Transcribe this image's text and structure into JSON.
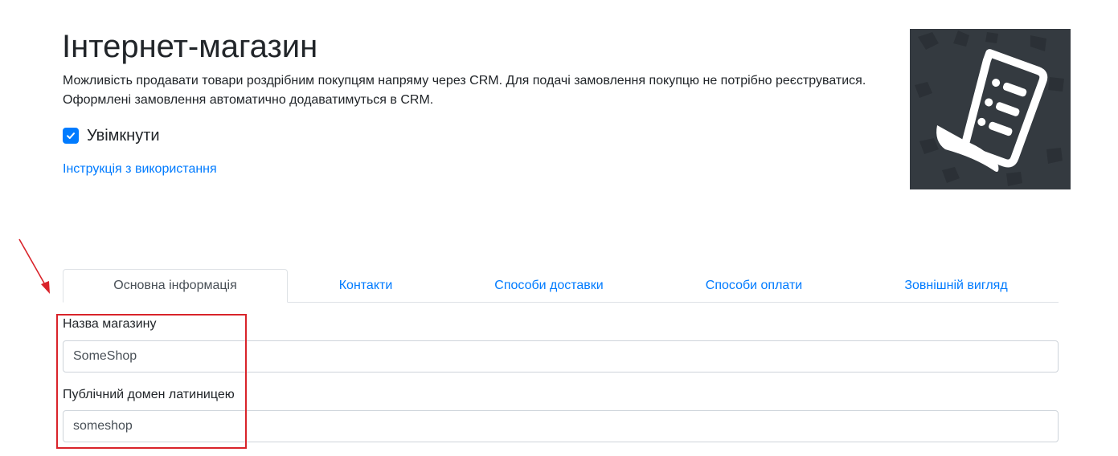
{
  "header": {
    "title": "Інтернет-магазин",
    "description_line1": "Можливість продавати товари роздрібним покупцям напряму через CRM. Для подачі замовлення покупцю не потрібно реєструватися.",
    "description_line2": "Оформлені замовлення автоматично додаватимуться в CRM.",
    "enable_label": "Увімкнути",
    "enabled": true,
    "instructions_link": "Інструкція з використання",
    "image_icon": "receipt-list-icon"
  },
  "tabs": [
    {
      "label": "Основна інформація",
      "active": true
    },
    {
      "label": "Контакти",
      "active": false
    },
    {
      "label": "Способи доставки",
      "active": false
    },
    {
      "label": "Способи оплати",
      "active": false
    },
    {
      "label": "Зовнішній вигляд",
      "active": false
    }
  ],
  "form": {
    "shop_name_label": "Назва магазину",
    "shop_name_value": "SomeShop",
    "domain_label": "Публічний домен латиницею",
    "domain_value": "someshop"
  },
  "colors": {
    "accent": "#007bff",
    "annotation": "#d9232a",
    "image_background": "#343a40"
  }
}
